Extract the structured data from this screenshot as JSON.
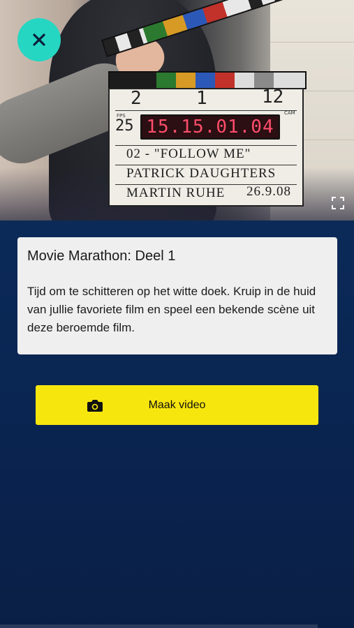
{
  "header_image": {
    "alt": "clapperboard",
    "clapperboard": {
      "scene_left": "2",
      "scene_mid": "1",
      "scene_right": "12",
      "fps": "25",
      "fps_label": "FPS",
      "cam_label": "CAM",
      "timecode": "15.15.01.04",
      "title_line": "02 - \"FOLLOW ME\"",
      "director_line": "PATRICK DAUGHTERS",
      "camera_line": "MARTIN RUHE",
      "date": "26.9.08"
    }
  },
  "close_button": {
    "icon": "close-icon"
  },
  "fullscreen": {
    "icon": "fullscreen-icon"
  },
  "card": {
    "title": "Movie Marathon: Deel 1",
    "description": "Tijd om te schitteren op het witte doek. Kruip in de huid van jullie favoriete film en speel een bekende scène uit deze beroemde film."
  },
  "action_button": {
    "label": "Maak video",
    "icon": "camera-icon"
  },
  "colors": {
    "background": "#0b2a58",
    "close_button": "#25d6c2",
    "action_button": "#f7e60e",
    "card": "#efefef"
  }
}
